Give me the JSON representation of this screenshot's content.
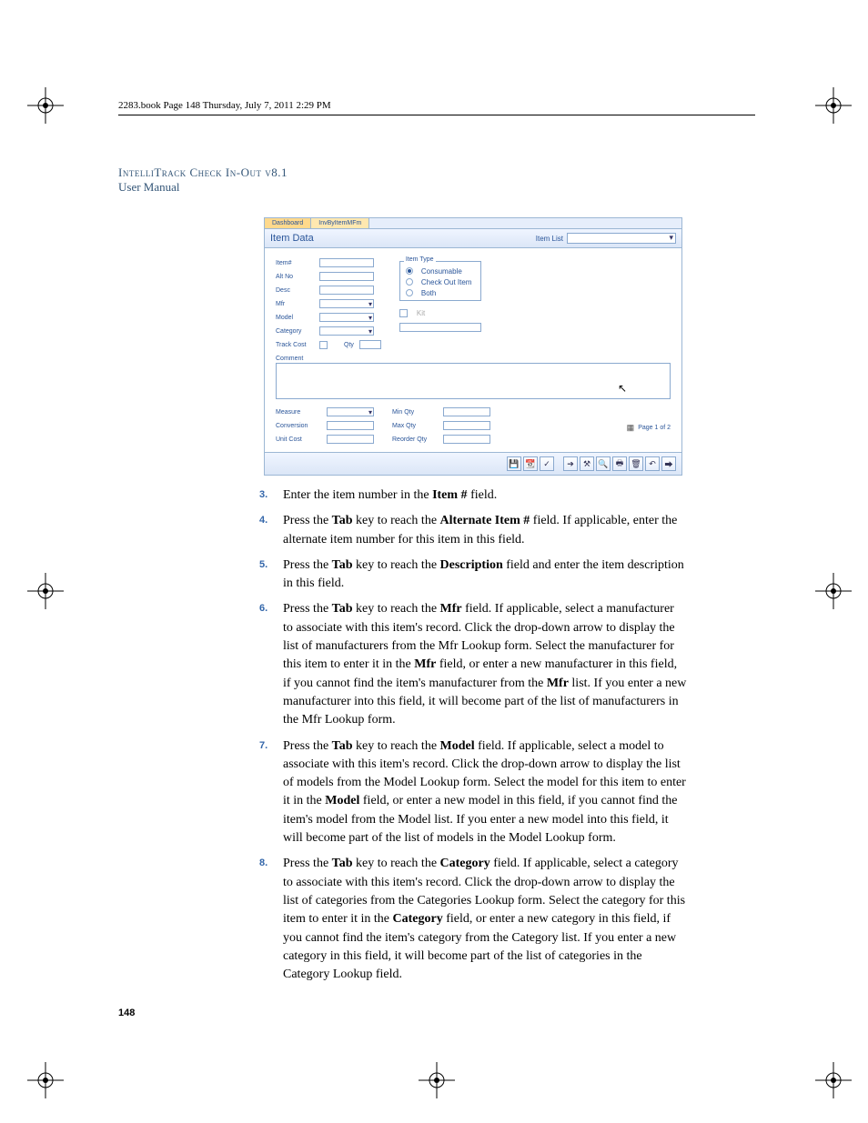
{
  "header_line": "2283.book  Page 148  Thursday, July 7, 2011  2:29 PM",
  "doc_title": "IntelliTrack Check In-Out v8.1",
  "doc_subtitle": "User Manual",
  "page_number": "148",
  "screenshot": {
    "tab1": "Dashboard",
    "tab2": "InvByItemMFm",
    "title": "Item Data",
    "item_list_label": "Item List",
    "fields": {
      "item_no": "Item#",
      "alt_no": "Alt No",
      "desc": "Desc",
      "mfr": "Mfr",
      "model": "Model",
      "category": "Category",
      "track_cost": "Track Cost",
      "qty": "Qty"
    },
    "item_type": {
      "title": "Item Type",
      "consumable": "Consumable",
      "checkout": "Check Out Item",
      "both": "Both"
    },
    "kit": "Kit",
    "comment": "Comment",
    "measure": "Measure",
    "conversion": "Conversion",
    "unit_cost": "Unit Cost",
    "min_qty": "Min Qty",
    "max_qty": "Max Qty",
    "reorder_qty": "Reorder Qty",
    "pager": "Page 1 of 2"
  },
  "steps": {
    "s3_num": "3.",
    "s3_a": "Enter the item number in the ",
    "s3_b": "Item #",
    "s3_c": " field.",
    "s4_num": "4.",
    "s4_a": "Press the ",
    "s4_b": "Tab",
    "s4_c": " key to reach the ",
    "s4_d": "Alternate Item #",
    "s4_e": " field. If applicable, enter the alternate item number for this item in this field.",
    "s5_num": "5.",
    "s5_a": "Press the ",
    "s5_b": "Tab",
    "s5_c": " key to reach the ",
    "s5_d": "Description",
    "s5_e": " field and enter the item description in this field.",
    "s6_num": "6.",
    "s6_a": "Press the ",
    "s6_b": "Tab",
    "s6_c": " key to reach the ",
    "s6_d": "Mfr",
    "s6_e": " field. If applicable, select a manufacturer to associate with this item's record. Click the drop-down arrow to display the list of manufacturers from the Mfr Lookup form. Select the manufacturer for this item to enter it in the ",
    "s6_f": "Mfr",
    "s6_g": " field, or enter a new manufacturer in this field, if you cannot find the item's manufacturer from the ",
    "s6_h": "Mfr",
    "s6_i": " list. If you enter a new manufacturer into this field, it will become part of the list of manufacturers in the Mfr Lookup form.",
    "s7_num": "7.",
    "s7_a": "Press the ",
    "s7_b": "Tab",
    "s7_c": " key to reach the ",
    "s7_d": "Model",
    "s7_e": " field. If applicable, select a model to associate with this item's record. Click the drop-down arrow to display the list of models from the Model Lookup form. Select the model for this item to enter it in the ",
    "s7_f": "Model",
    "s7_g": " field, or enter a new model in this field, if you cannot find the item's model from the Model list. If you enter a new model into this field, it will become part of the list of models in the Model Lookup form.",
    "s8_num": "8.",
    "s8_a": "Press the ",
    "s8_b": "Tab",
    "s8_c": " key to reach the ",
    "s8_d": "Category",
    "s8_e": " field. If applicable, select a category to associate with this item's record. Click the drop-down arrow to display the list of categories from the Categories Lookup form. Select the category for this item to enter it in the ",
    "s8_f": "Category",
    "s8_g": " field, or enter a new category in this field, if you cannot find the item's category from the Category list. If you enter a new category in this field, it will become part of the list of categories in the Category Lookup field."
  }
}
